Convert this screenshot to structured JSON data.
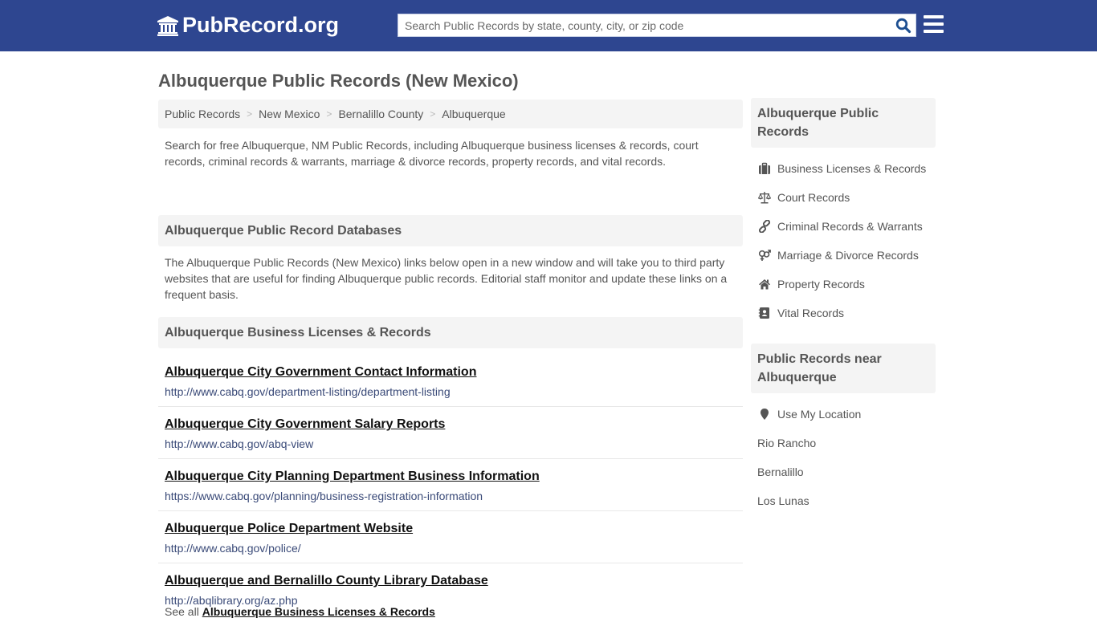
{
  "header": {
    "logo_text": "PubRecord.org",
    "search_placeholder": "Search Public Records by state, county, city, or zip code",
    "search_value": ""
  },
  "page_title": "Albuquerque Public Records (New Mexico)",
  "breadcrumb": [
    "Public Records",
    "New Mexico",
    "Bernalillo County",
    "Albuquerque"
  ],
  "breadcrumb_separator": ">",
  "intro": "Search for free Albuquerque, NM Public Records, including Albuquerque business licenses & records, court records, criminal records & warrants, marriage & divorce records, property records, and vital records.",
  "databases": {
    "heading": "Albuquerque Public Record Databases",
    "description": "The Albuquerque Public Records (New Mexico) links below open in a new window and will take you to third party websites that are useful for finding Albuquerque public records. Editorial staff monitor and update these links on a frequent basis."
  },
  "business_section": {
    "heading": "Albuquerque Business Licenses & Records",
    "records": [
      {
        "title": "Albuquerque City Government Contact Information",
        "url": "http://www.cabq.gov/department-listing/department-listing"
      },
      {
        "title": "Albuquerque City Government Salary Reports",
        "url": "http://www.cabq.gov/abq-view"
      },
      {
        "title": "Albuquerque City Planning Department Business Information",
        "url": "https://www.cabq.gov/planning/business-registration-information"
      },
      {
        "title": "Albuquerque Police Department Website",
        "url": "http://www.cabq.gov/police/"
      },
      {
        "title": "Albuquerque and Bernalillo County Library Database",
        "url": "http://abqlibrary.org/az.php"
      }
    ],
    "see_all_prefix": "See all",
    "see_all_link": "Albuquerque Business Licenses & Records"
  },
  "sidebar": {
    "records_heading": "Albuquerque Public Records",
    "records_items": [
      {
        "label": "Business Licenses & Records",
        "icon": "briefcase-icon"
      },
      {
        "label": "Court Records",
        "icon": "balance-scale-icon"
      },
      {
        "label": "Criminal Records & Warrants",
        "icon": "link-icon"
      },
      {
        "label": "Marriage & Divorce Records",
        "icon": "venus-mars-icon"
      },
      {
        "label": "Property Records",
        "icon": "home-icon"
      },
      {
        "label": "Vital Records",
        "icon": "address-book-icon"
      }
    ],
    "nearby_heading": "Public Records near Albuquerque",
    "use_location_label": "Use My Location",
    "nearby_items": [
      "Rio Rancho",
      "Bernalillo",
      "Los Lunas"
    ]
  },
  "colors": {
    "header_bg": "#2e4690",
    "search_icon": "#1d4f91",
    "panel_bg": "#f4f4f4",
    "text": "#555555",
    "link_title": "#111111",
    "url_text": "#3a4a78"
  }
}
